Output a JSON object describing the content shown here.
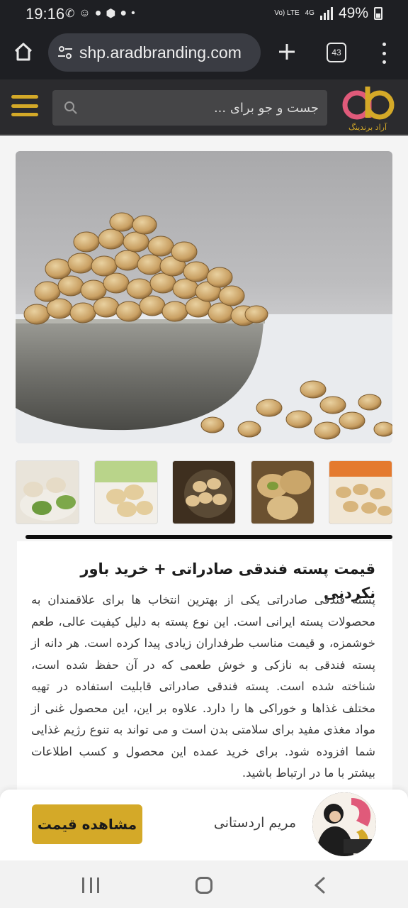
{
  "status_bar": {
    "time": "19:16",
    "battery": "49%",
    "network": "4G",
    "volte": "Vo) LTE"
  },
  "browser": {
    "url": "shp.aradbranding.com",
    "tab_count": "43"
  },
  "site": {
    "search_placeholder": "جست و جو برای ...",
    "logo_text": "آراد برندینگ"
  },
  "product": {
    "title": "قیمت پسته فندقی صادراتی + خرید باور نکردنی",
    "description": "پسته فندقی صادراتی یکی از بهترین انتخاب ها برای علاقمندان به محصولات پسته ایرانی است. این نوع پسته به دلیل کیفیت عالی، طعم خوشمزه، و قیمت مناسب طرفداران زیادی پیدا کرده است. هر دانه از پسته فندقی به نازکی و خوش طعمی که در آن حفظ شده است، شناخته شده است. پسته فندقی صادراتی قابلیت استفاده در تهیه مختلف غذاها و خوراکی ها را دارد. علاوه بر این، این محصول غنی از مواد مغذی مفید برای سلامتی بدن است و می تواند به تنوع رژیم غذایی شما افزوده شود. برای خرید عمده این محصول و کسب اطلاعات بیشتر با ما در ارتباط باشید."
  },
  "contact": {
    "agent_name": "مریم اردستانی",
    "price_button": "مشاهده قیمت"
  },
  "colors": {
    "accent": "#d4a928",
    "header_bg": "#2b2b2e",
    "page_bg": "#f4f4f4"
  }
}
